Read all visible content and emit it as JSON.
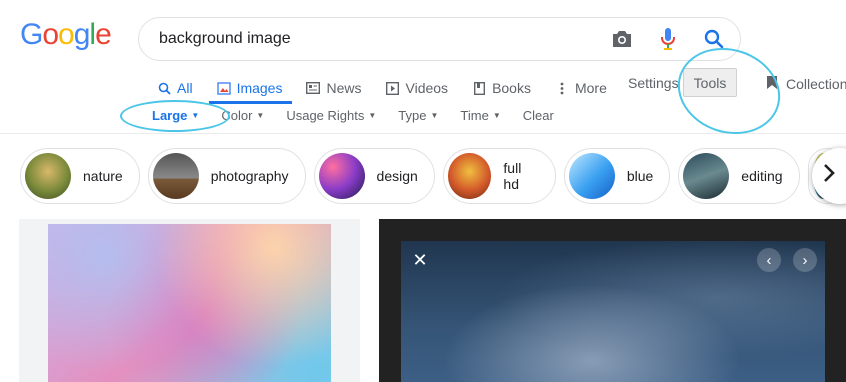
{
  "logo": {
    "text": "Google"
  },
  "search": {
    "value": "background image"
  },
  "tabs": [
    {
      "label": "All"
    },
    {
      "label": "Images"
    },
    {
      "label": "News"
    },
    {
      "label": "Videos"
    },
    {
      "label": "Books"
    },
    {
      "label": "More"
    }
  ],
  "header": {
    "settings_label": "Settings",
    "tools_label": "Tools",
    "collections_label": "Collections"
  },
  "filters": [
    {
      "label": "Large"
    },
    {
      "label": "Color"
    },
    {
      "label": "Usage Rights"
    },
    {
      "label": "Type"
    },
    {
      "label": "Time"
    },
    {
      "label": "Clear"
    }
  ],
  "chips": [
    {
      "label": "nature"
    },
    {
      "label": "photography"
    },
    {
      "label": "design"
    },
    {
      "label": "full hd"
    },
    {
      "label": "blue"
    },
    {
      "label": "editing"
    }
  ],
  "colors": {
    "accent": "#1a73e8",
    "annotation": "#4cc6e8"
  },
  "icons": {
    "search": "search-icon",
    "camera": "camera-icon",
    "mic": "microphone-icon",
    "next": "chevron-right-icon",
    "close": "close-icon"
  }
}
